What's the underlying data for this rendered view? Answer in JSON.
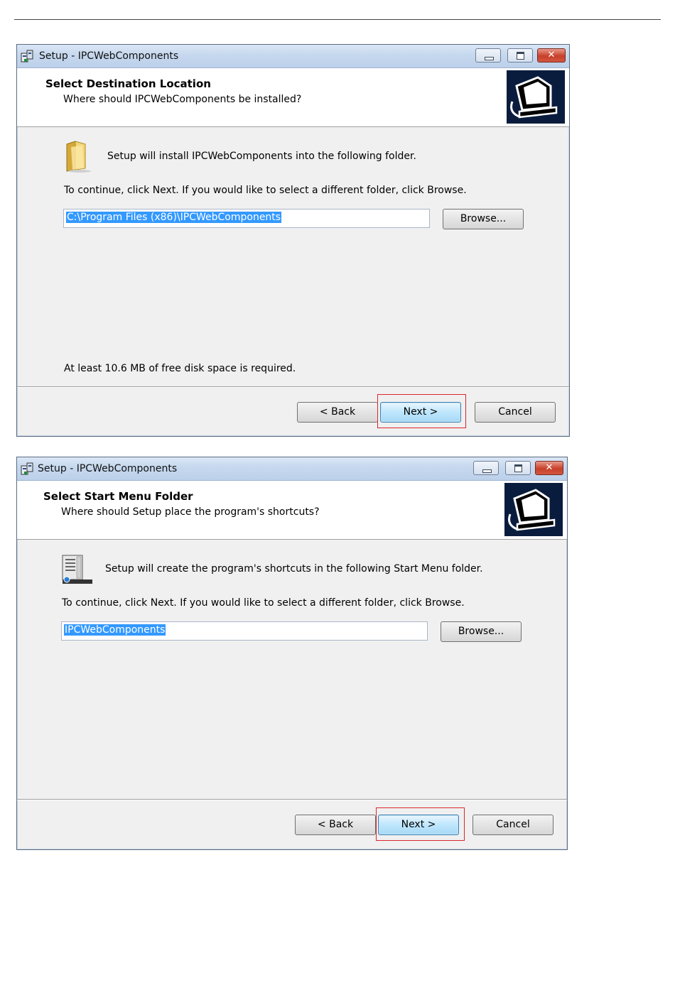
{
  "dialogs": [
    {
      "title": "Setup - IPCWebComponents",
      "header_title": "Select Destination Location",
      "header_subtitle": "Where should IPCWebComponents be installed?",
      "icon": "folder-icon",
      "intro_text": "Setup will install IPCWebComponents into the following folder.",
      "instruction": "To continue, click Next. If you would like to select a different folder, click Browse.",
      "path_value": "C:\\Program Files (x86)\\IPCWebComponents",
      "browse_label": "Browse...",
      "footnote": "At least 10.6 MB of free disk space is required.",
      "back_label": "< Back",
      "next_label": "Next >",
      "cancel_label": "Cancel"
    },
    {
      "title": "Setup - IPCWebComponents",
      "header_title": "Select Start Menu Folder",
      "header_subtitle": "Where should Setup place the program's shortcuts?",
      "icon": "start-menu-icon",
      "intro_text": "Setup will create the program's shortcuts in the following Start Menu folder.",
      "instruction": "To continue, click Next. If you would like to select a different folder, click Browse.",
      "path_value": "IPCWebComponents",
      "browse_label": "Browse...",
      "back_label": "< Back",
      "next_label": "Next >",
      "cancel_label": "Cancel"
    }
  ],
  "colors": {
    "highlight": "#d9262e",
    "selection": "#3399ff",
    "titlebar": "#c6d8ee"
  }
}
